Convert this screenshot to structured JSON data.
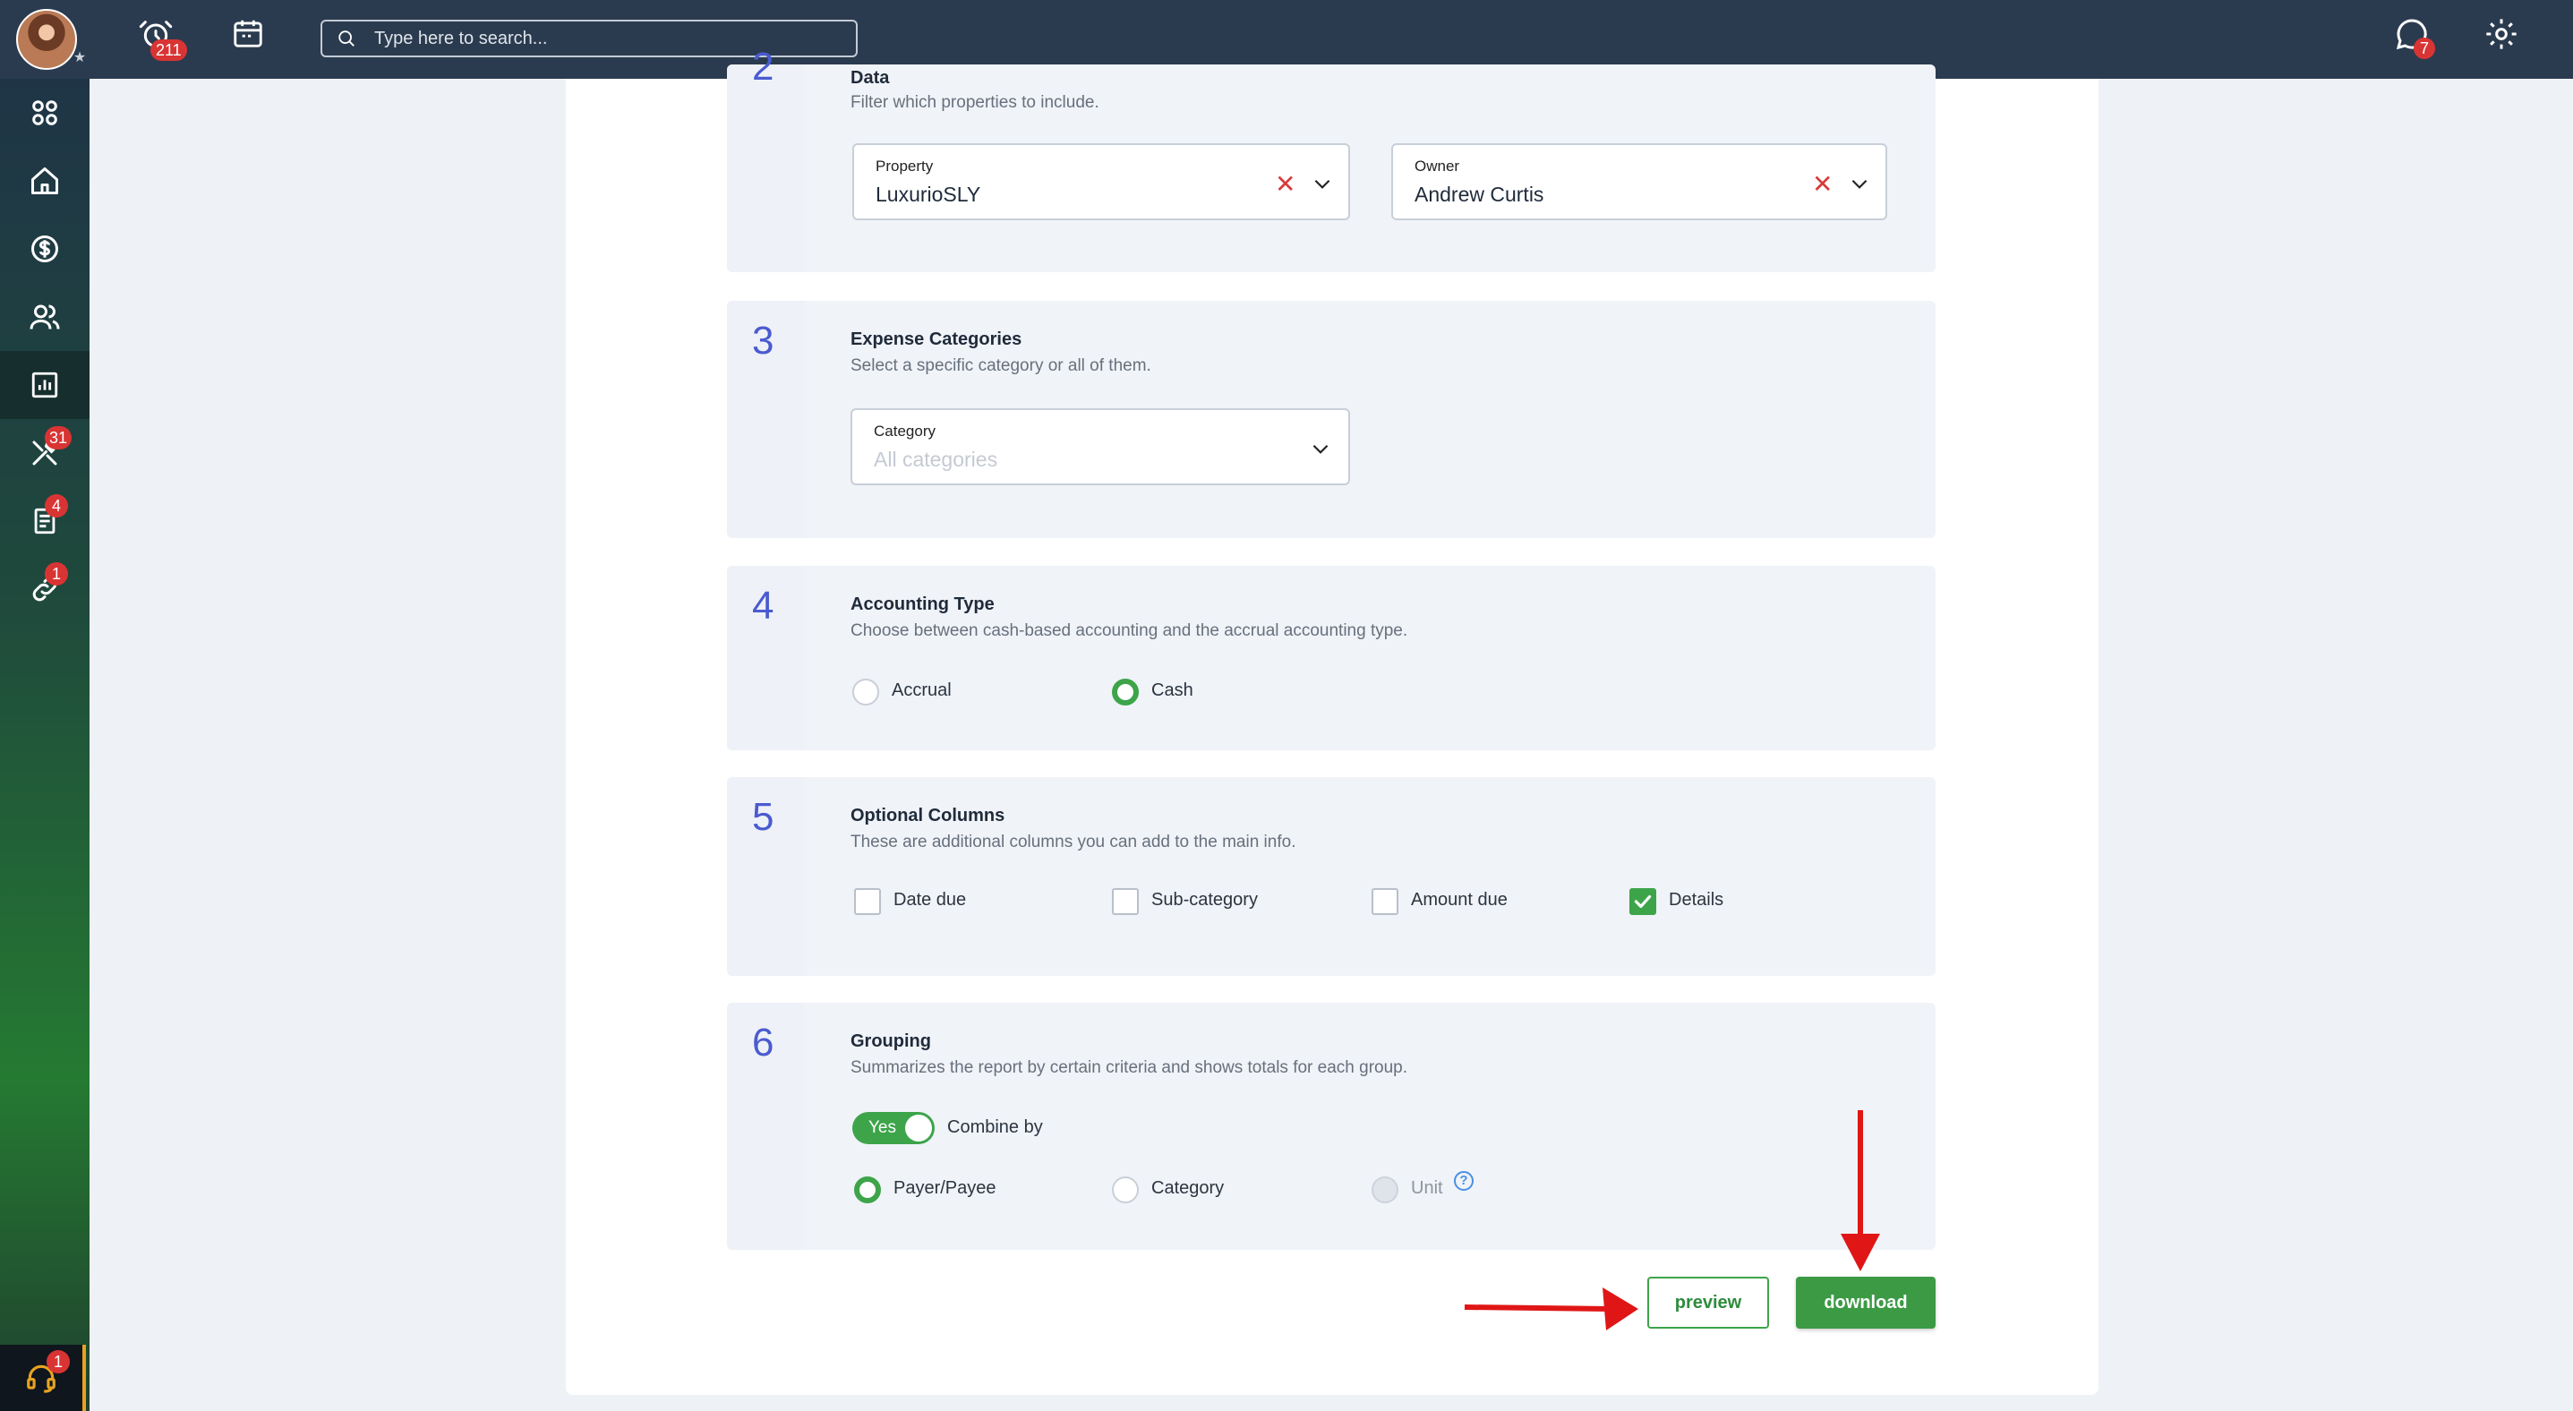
{
  "topbar": {
    "alerts_badge": "211",
    "search_placeholder": "Type here to search...",
    "messages_badge": "7"
  },
  "sidebar": {
    "items": [
      {
        "icon": "apps-grid-icon",
        "badge": ""
      },
      {
        "icon": "home-icon",
        "badge": ""
      },
      {
        "icon": "dollar-icon",
        "badge": ""
      },
      {
        "icon": "people-icon",
        "badge": ""
      },
      {
        "icon": "reports-chart-icon",
        "badge": "",
        "active": true
      },
      {
        "icon": "tools-icon",
        "badge": "31"
      },
      {
        "icon": "document-icon",
        "badge": "4"
      },
      {
        "icon": "link-icon",
        "badge": "1"
      }
    ],
    "support_badge": "1"
  },
  "sections": {
    "data": {
      "number": "2",
      "title": "Data",
      "description": "Filter which properties to include.",
      "property_label": "Property",
      "property_value": "LuxurioSLY",
      "owner_label": "Owner",
      "owner_value": "Andrew Curtis"
    },
    "expense": {
      "number": "3",
      "title": "Expense Categories",
      "description": "Select a specific category or all of them.",
      "category_label": "Category",
      "category_placeholder": "All categories"
    },
    "accounting": {
      "number": "4",
      "title": "Accounting Type",
      "description": "Choose between cash-based accounting and the accrual accounting type.",
      "options": [
        {
          "label": "Accrual",
          "selected": false
        },
        {
          "label": "Cash",
          "selected": true
        }
      ]
    },
    "columns": {
      "number": "5",
      "title": "Optional Columns",
      "description": "These are additional columns you can add to the main info.",
      "options": [
        {
          "label": "Date due",
          "checked": false
        },
        {
          "label": "Sub-category",
          "checked": false
        },
        {
          "label": "Amount due",
          "checked": false
        },
        {
          "label": "Details",
          "checked": true
        }
      ]
    },
    "grouping": {
      "number": "6",
      "title": "Grouping",
      "description": "Summarizes the report by certain criteria and shows totals for each group.",
      "toggle_label": "Yes",
      "combine_label": "Combine by",
      "options": [
        {
          "label": "Payer/Payee",
          "selected": true
        },
        {
          "label": "Category",
          "selected": false
        },
        {
          "label": "Unit",
          "selected": false,
          "disabled": true
        }
      ]
    }
  },
  "actions": {
    "preview": "preview",
    "download": "download"
  },
  "colors": {
    "accent_green": "#3da44a",
    "topbar": "#2b3b4f",
    "badge_red": "#d93434",
    "section_number": "#4a5bd0",
    "annotation_arrow": "#e01616"
  }
}
